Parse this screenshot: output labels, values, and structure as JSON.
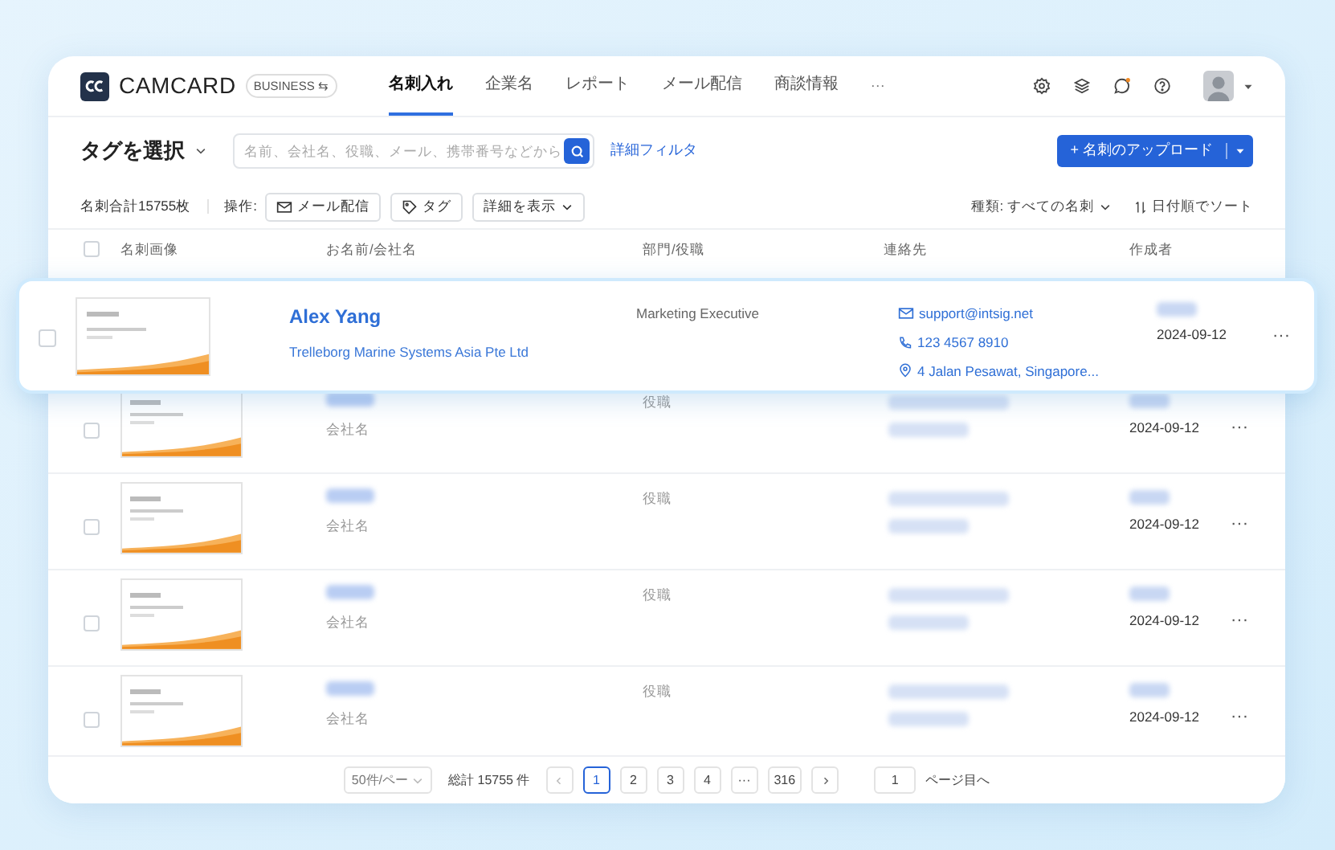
{
  "header": {
    "logo_text": "CAMCARD",
    "edition": "BUSINESS ⇆",
    "more": "···",
    "tabs": [
      {
        "label": "名刺入れ",
        "selected": true
      },
      {
        "label": "企業名",
        "selected": false
      },
      {
        "label": "レポート",
        "selected": false
      },
      {
        "label": "メール配信",
        "selected": false
      },
      {
        "label": "商談情報",
        "selected": false
      }
    ]
  },
  "toolbar": {
    "tag_select": "タグを選択",
    "search": {
      "placeholder": "名前、会社名、役職、メール、携帯番号などから"
    },
    "advanced_filter": "詳細フィルタ",
    "upload_button": "+ 名刺のアップロード"
  },
  "actions": {
    "summary": "名刺合計15755枚",
    "label": "操作:",
    "buttons": [
      {
        "kind": "mail",
        "label": "メール配信"
      },
      {
        "kind": "tag",
        "label": "タグ"
      },
      {
        "kind": "dropdown",
        "label": "詳細を表示"
      }
    ],
    "type_filter": "種類: すべての名刺",
    "sort": "日付順でソート"
  },
  "table": {
    "header_checkbox": {
      "checked": false
    },
    "columns": [
      "名刺画像",
      "お名前/会社名",
      "部門/役職",
      "連絡先",
      "作成者"
    ],
    "featured_row": {
      "checked": false,
      "name": "Alex Yang",
      "company": "Trelleborg Marine Systems Asia Pte Ltd",
      "title": "Marketing Executive",
      "email": "support@intsig.net",
      "phone": "123 4567 8910",
      "address": "4 Jalan Pesawat, Singapore...",
      "date": "2024-09-12",
      "menu": "···"
    },
    "rows": [
      {
        "checked": false,
        "company": "会社名",
        "title": "役職",
        "date": "2024-09-12",
        "menu": "···"
      },
      {
        "checked": false,
        "company": "会社名",
        "title": "役職",
        "date": "2024-09-12",
        "menu": "···"
      },
      {
        "checked": false,
        "company": "会社名",
        "title": "役職",
        "date": "2024-09-12",
        "menu": "···"
      },
      {
        "checked": false,
        "company": "会社名",
        "title": "役職",
        "date": "2024-09-12",
        "menu": "···"
      }
    ]
  },
  "pagination": {
    "page_size": "50件/ペー",
    "total": "総計 15755 件",
    "pages": [
      {
        "label": "1",
        "selected": true
      },
      {
        "label": "2",
        "selected": false
      },
      {
        "label": "3",
        "selected": false
      },
      {
        "label": "4",
        "selected": false
      },
      {
        "label": "···",
        "selected": false
      },
      {
        "label": "316",
        "selected": false
      }
    ],
    "jump_value": "1",
    "jump_label": "ページ目へ"
  }
}
